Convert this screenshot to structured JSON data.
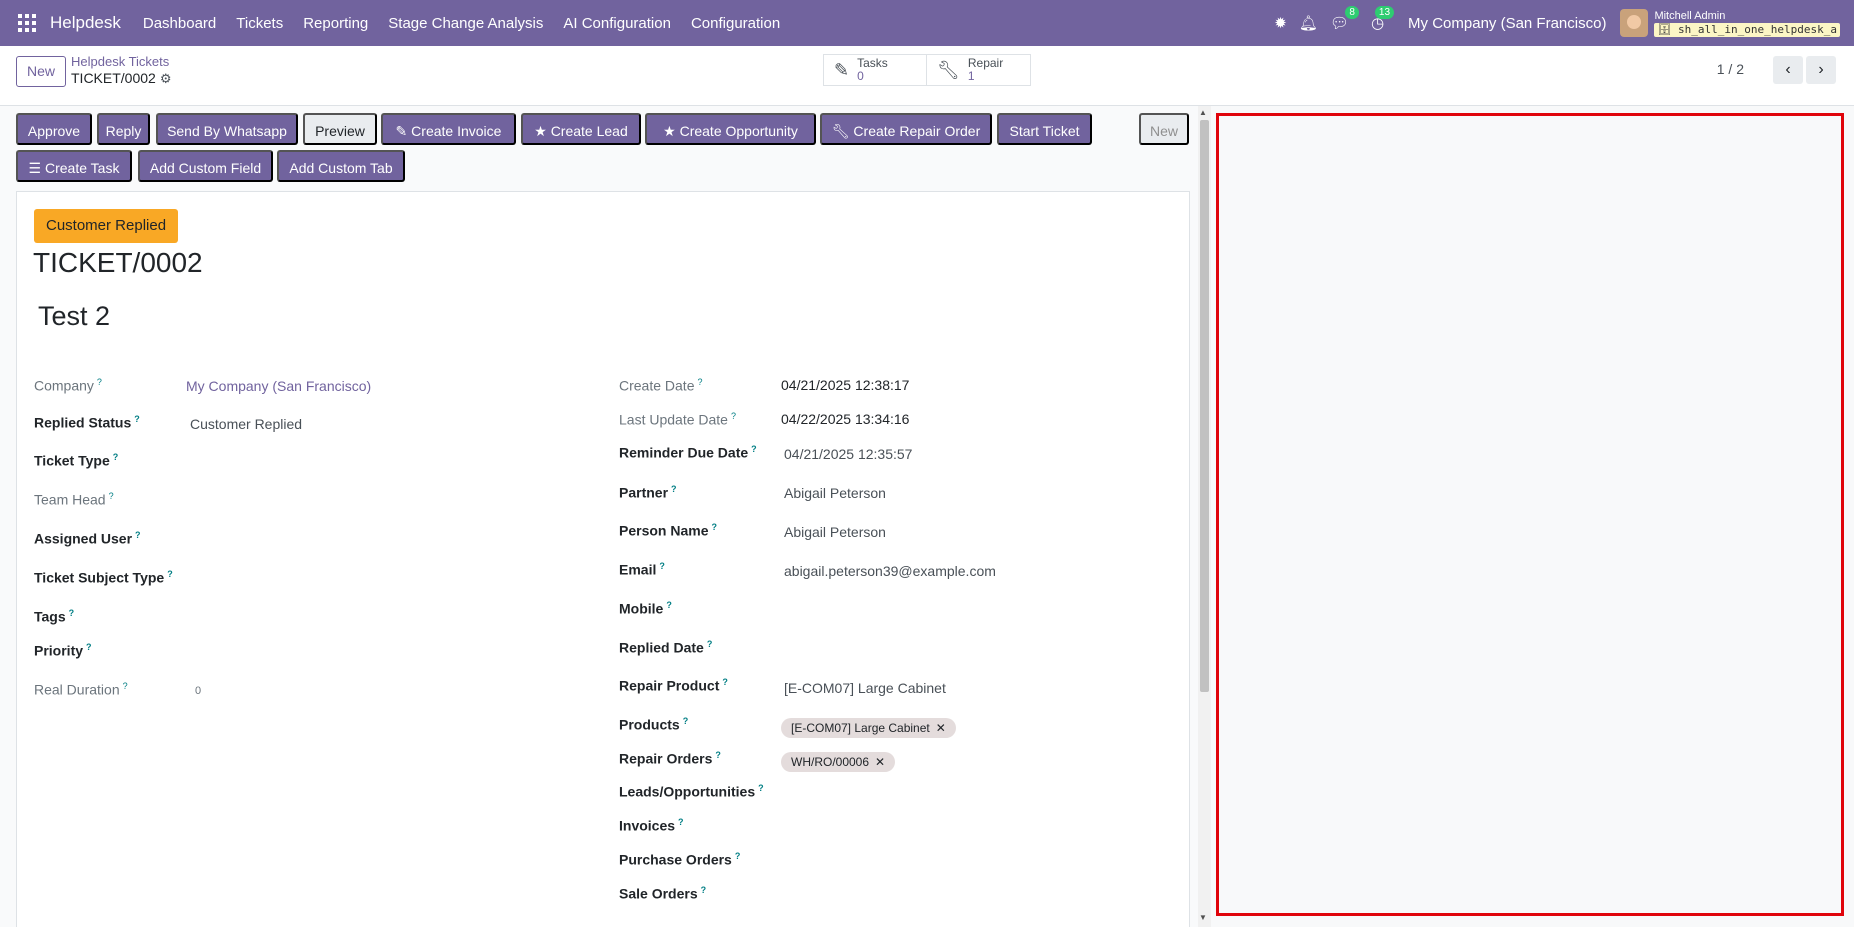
{
  "navbar": {
    "brand": "Helpdesk",
    "menu": [
      "Dashboard",
      "Tickets",
      "Reporting",
      "Stage Change Analysis",
      "AI Configuration",
      "Configuration"
    ],
    "chat_badge": "8",
    "activity_badge": "13",
    "company": "My Company (San Francisco)",
    "user_name": "Mitchell Admin",
    "db_name": "sh_all_in_one_helpdesk_a"
  },
  "control": {
    "new_label": "New",
    "breadcrumb": "Helpdesk Tickets",
    "record_name": "TICKET/0002",
    "smart": [
      {
        "label": "Tasks",
        "value": "0"
      },
      {
        "label": "Repair",
        "value": "1"
      }
    ],
    "pager": "1 / 2"
  },
  "actions": {
    "approve": "Approve",
    "reply": "Reply",
    "whatsapp": "Send By Whatsapp",
    "preview": "Preview",
    "invoice": "Create Invoice",
    "lead": "Create Lead",
    "opportunity": "Create Opportunity",
    "repair_order": "Create Repair Order",
    "start_ticket": "Start Ticket",
    "new_stage": "New",
    "task": "Create Task",
    "custom_field": "Add Custom Field",
    "custom_tab": "Add Custom Tab"
  },
  "form": {
    "status_badge": "Customer Replied",
    "ticket_no": "TICKET/0002",
    "title": "Test 2",
    "left": {
      "company_label": "Company",
      "company_value": "My Company (San Francisco)",
      "replied_status_label": "Replied Status",
      "replied_status_value": "Customer Replied",
      "ticket_type_label": "Ticket Type",
      "team_head_label": "Team Head",
      "assigned_user_label": "Assigned User",
      "subject_type_label": "Ticket Subject Type",
      "tags_label": "Tags",
      "priority_label": "Priority",
      "real_duration_label": "Real Duration",
      "real_duration_value": "0"
    },
    "right": {
      "create_date_label": "Create Date",
      "create_date_value": "04/21/2025 12:38:17",
      "last_update_label": "Last Update Date",
      "last_update_value": "04/22/2025 13:34:16",
      "reminder_label": "Reminder Due Date",
      "reminder_value": "04/21/2025 12:35:57",
      "partner_label": "Partner",
      "partner_value": "Abigail Peterson",
      "person_label": "Person Name",
      "person_value": "Abigail Peterson",
      "email_label": "Email",
      "email_value": "abigail.peterson39@example.com",
      "mobile_label": "Mobile",
      "replied_date_label": "Replied Date",
      "repair_product_label": "Repair Product",
      "repair_product_value": "[E-COM07] Large Cabinet",
      "products_label": "Products",
      "products_tag": "[E-COM07] Large Cabinet",
      "repair_orders_label": "Repair Orders",
      "repair_orders_tag": "WH/RO/00006",
      "leads_label": "Leads/Opportunities",
      "invoices_label": "Invoices",
      "purchase_label": "Purchase Orders",
      "sale_label": "Sale Orders"
    }
  }
}
